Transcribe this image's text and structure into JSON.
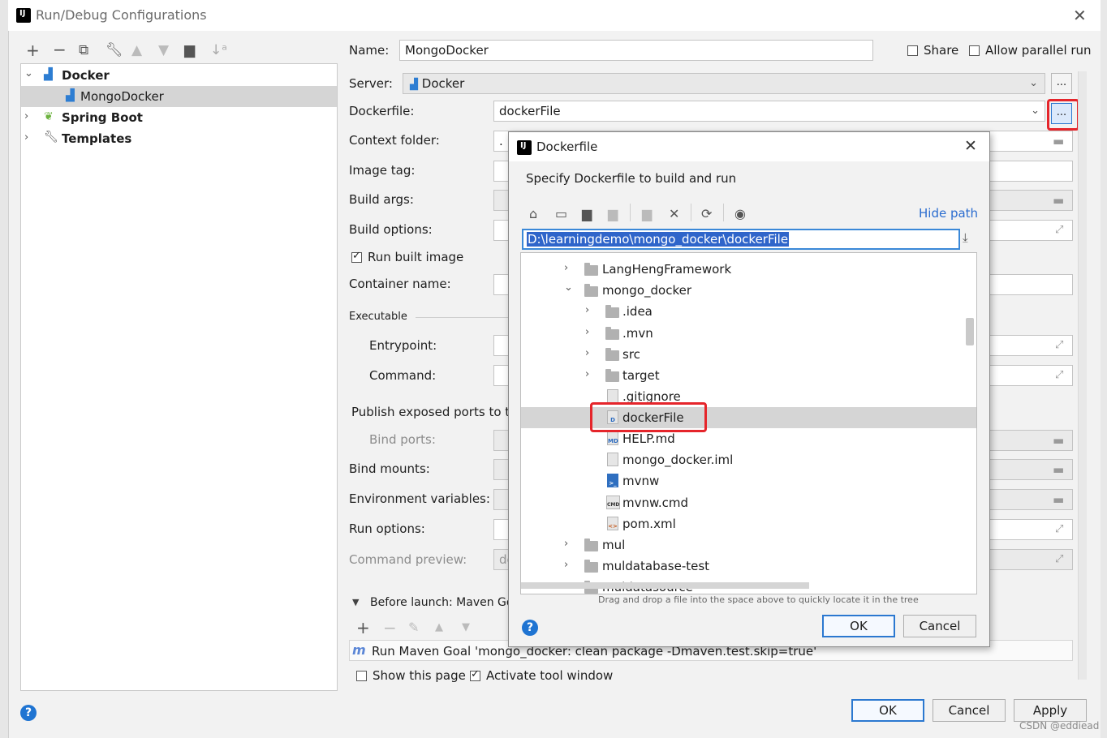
{
  "window": {
    "title": "Run/Debug Configurations",
    "app_logo_text": "IJ"
  },
  "sidebar": {
    "toolbar_icons": [
      "plus-icon",
      "minus-icon",
      "copy-icon",
      "wrench-icon",
      "arrow-up-icon",
      "arrow-down-icon",
      "folder-add-icon",
      "sort-icon"
    ],
    "items": [
      {
        "label": "Docker",
        "level": 0,
        "expanded": true,
        "bold": true
      },
      {
        "label": "MongoDocker",
        "level": 1,
        "selected": true
      },
      {
        "label": "Spring Boot",
        "level": 0,
        "expanded": false,
        "bold": true
      },
      {
        "label": "Templates",
        "level": 0,
        "expanded": false,
        "bold": true
      }
    ]
  },
  "form": {
    "name_label": "Name:",
    "name_value": "MongoDocker",
    "share_label": "Share",
    "allow_parallel_label": "Allow parallel run",
    "server_label": "Server:",
    "server_value": "Docker",
    "dots": "...",
    "dockerfile_label": "Dockerfile:",
    "dockerfile_value": "dockerFile",
    "context_folder_label": "Context folder:",
    "context_folder_value": ".",
    "image_tag_label": "Image tag:",
    "build_args_label": "Build args:",
    "build_options_label": "Build options:",
    "run_built_image_label": "Run built image",
    "container_name_label": "Container name:",
    "executable_label": "Executable",
    "entrypoint_label": "Entrypoint:",
    "command_label": "Command:",
    "publish_ports_label": "Publish exposed ports to t",
    "bind_ports_label": "Bind ports:",
    "bind_mounts_label": "Bind mounts:",
    "env_vars_label": "Environment variables:",
    "run_options_label": "Run options:",
    "command_preview_label": "Command preview:",
    "command_preview_value": "dc",
    "before_launch_label": "Before launch: Maven Go",
    "maven_goal_icon": "m",
    "maven_goal": "Run Maven Goal 'mongo_docker: clean package -Dmaven.test.skip=true'",
    "show_page_label": "Show this page",
    "activate_tool_label": "Activate tool window"
  },
  "footer": {
    "ok": "OK",
    "cancel": "Cancel",
    "apply": "Apply",
    "help": "?"
  },
  "dialog": {
    "title": "Dockerfile",
    "subtitle": "Specify Dockerfile to build and run",
    "hide_path": "Hide path",
    "path": "D:\\learningdemo\\mongo_docker\\dockerFile",
    "drag_hint": "Drag and drop a file into the space above to quickly locate it in the tree",
    "ok": "OK",
    "cancel": "Cancel",
    "help": "?",
    "tree": [
      {
        "label": "LangHengFramework",
        "type": "folder",
        "level": 0,
        "arrow": "›"
      },
      {
        "label": "mongo_docker",
        "type": "folder",
        "level": 0,
        "arrow": "⌄"
      },
      {
        "label": ".idea",
        "type": "folder",
        "level": 1,
        "arrow": "›"
      },
      {
        "label": ".mvn",
        "type": "folder",
        "level": 1,
        "arrow": "›"
      },
      {
        "label": "src",
        "type": "folder",
        "level": 1,
        "arrow": "›"
      },
      {
        "label": "target",
        "type": "folder",
        "level": 1,
        "arrow": "›"
      },
      {
        "label": ".gitignore",
        "type": "file",
        "level": 1,
        "icon_text": ""
      },
      {
        "label": "dockerFile",
        "type": "file",
        "level": 1,
        "icon_text": "D",
        "selected": true
      },
      {
        "label": "HELP.md",
        "type": "file",
        "level": 1,
        "icon_text": "MD"
      },
      {
        "label": "mongo_docker.iml",
        "type": "file",
        "level": 1,
        "icon_text": ""
      },
      {
        "label": "mvnw",
        "type": "file",
        "level": 1,
        "icon_text": ">_"
      },
      {
        "label": "mvnw.cmd",
        "type": "file",
        "level": 1,
        "icon_text": "CMD"
      },
      {
        "label": "pom.xml",
        "type": "file",
        "level": 1,
        "icon_text": "<>"
      },
      {
        "label": "mul",
        "type": "folder",
        "level": 0,
        "arrow": "›"
      },
      {
        "label": "muldatabase-test",
        "type": "folder",
        "level": 0,
        "arrow": "›"
      },
      {
        "label": "muldatasource",
        "type": "folder",
        "level": 0,
        "arrow": "›"
      }
    ]
  },
  "watermark": "CSDN @eddiead",
  "colors": {
    "accent": "#2b78d0",
    "highlight": "#e5252b",
    "selection": "#d5d5d5"
  }
}
